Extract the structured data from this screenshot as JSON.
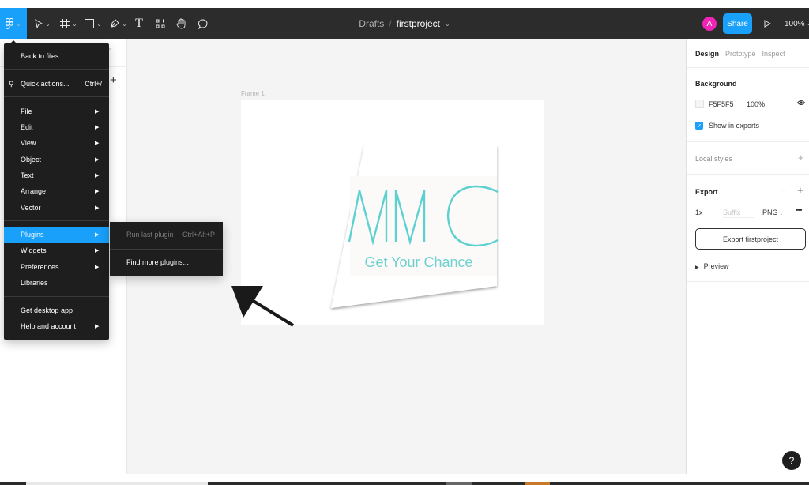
{
  "toolbar": {
    "tools": [
      {
        "name": "main-menu",
        "icon": "figma-logo-icon",
        "has_dropdown": true,
        "active": true
      },
      {
        "name": "move",
        "icon": "move-cursor-icon",
        "has_dropdown": true
      },
      {
        "name": "frame",
        "icon": "frame-hash-icon",
        "has_dropdown": true
      },
      {
        "name": "shape",
        "icon": "rectangle-icon",
        "has_dropdown": true
      },
      {
        "name": "pen",
        "icon": "pen-nib-icon",
        "has_dropdown": true
      },
      {
        "name": "text",
        "icon": "text-T-icon",
        "glyph": "T"
      },
      {
        "name": "resources",
        "icon": "components-grid-icon"
      },
      {
        "name": "hand",
        "icon": "hand-icon"
      },
      {
        "name": "comment",
        "icon": "speech-bubble-icon"
      }
    ],
    "breadcrumb": {
      "folder": "Drafts",
      "separator": "/",
      "file": "firstproject"
    },
    "avatar_initial": "A",
    "share_label": "Share",
    "zoom_level": "100%",
    "accent_color": "#18a0fb",
    "avatar_color": "#f024b5"
  },
  "main_menu": {
    "items": [
      {
        "label": "Back to files"
      },
      {
        "label": "Quick actions...",
        "shortcut": "Ctrl+/",
        "icon": "search-icon"
      },
      {
        "label": "File",
        "submenu": true
      },
      {
        "label": "Edit",
        "submenu": true
      },
      {
        "label": "View",
        "submenu": true
      },
      {
        "label": "Object",
        "submenu": true
      },
      {
        "label": "Text",
        "submenu": true
      },
      {
        "label": "Arrange",
        "submenu": true
      },
      {
        "label": "Vector",
        "submenu": true
      },
      {
        "label": "Plugins",
        "submenu": true,
        "active": true
      },
      {
        "label": "Widgets",
        "submenu": true
      },
      {
        "label": "Preferences",
        "submenu": true
      },
      {
        "label": "Libraries"
      },
      {
        "label": "Get desktop app"
      },
      {
        "label": "Help and account",
        "submenu": true
      }
    ]
  },
  "plugins_submenu": {
    "items": [
      {
        "label": "Run last plugin",
        "shortcut": "Ctrl+Alt+P",
        "disabled": true
      },
      {
        "label": "Find more plugins..."
      }
    ]
  },
  "canvas": {
    "frame_label": "Frame 1",
    "artwork": {
      "logo_text": "MMC",
      "tagline": "Get Your Chance",
      "logo_color": "#5fd0d0"
    },
    "background_color": "#f4f4f4"
  },
  "right_panel": {
    "tabs": [
      {
        "label": "Design",
        "active": true
      },
      {
        "label": "Prototype"
      },
      {
        "label": "Inspect"
      }
    ],
    "background": {
      "heading": "Background",
      "hex": "F5F5F5",
      "opacity": "100%",
      "show_in_exports": true,
      "show_in_exports_label": "Show in exports"
    },
    "local_styles_label": "Local styles",
    "export": {
      "heading": "Export",
      "scale": "1x",
      "suffix_placeholder": "Suffix",
      "format": "PNG",
      "button_label": "Export firstproject"
    },
    "preview_label": "Preview"
  },
  "help_label": "?"
}
